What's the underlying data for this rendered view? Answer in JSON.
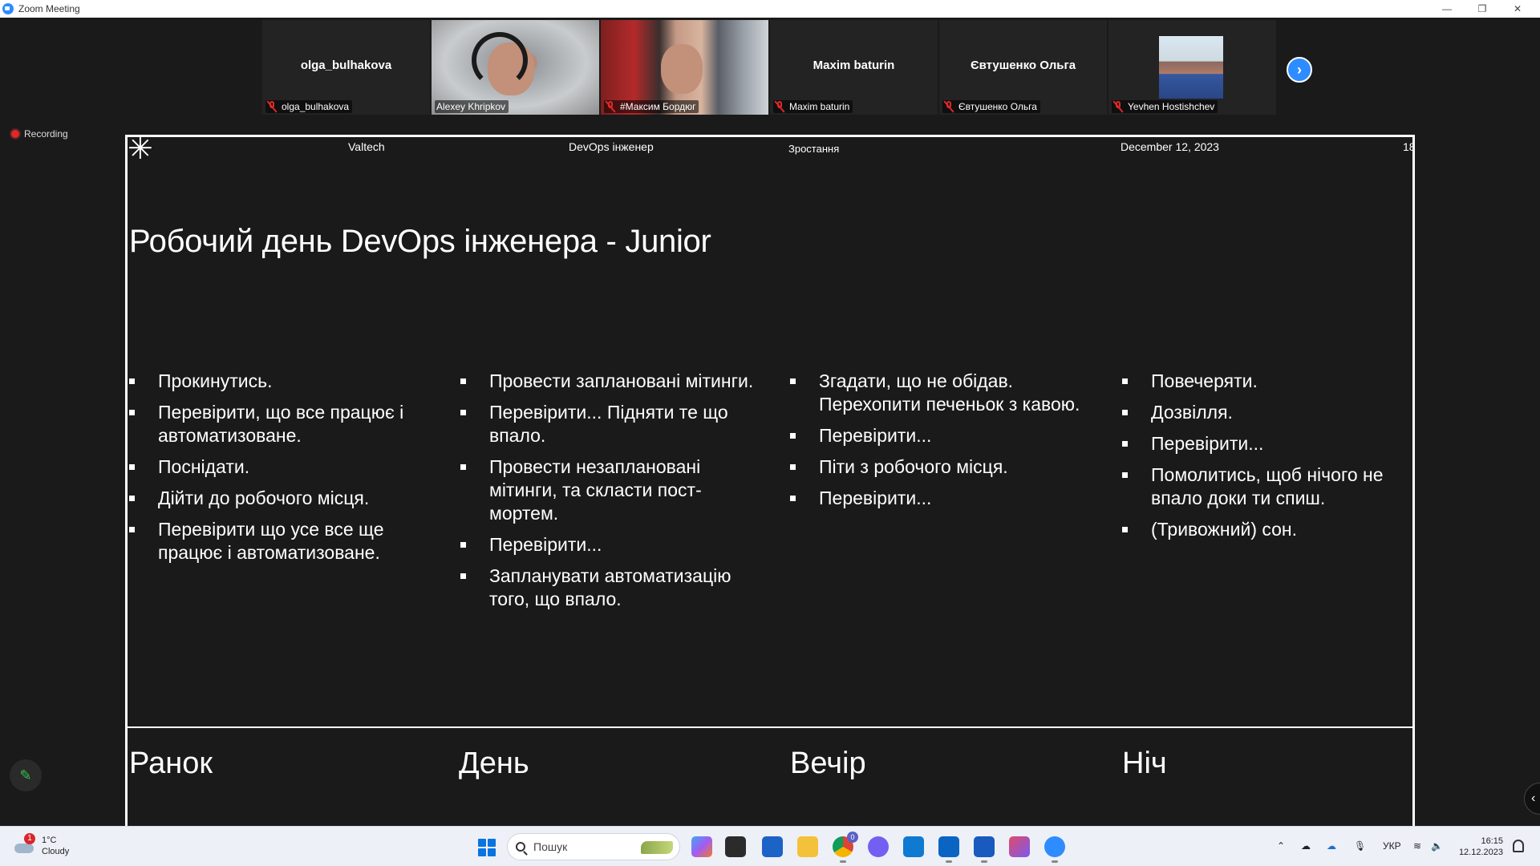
{
  "window": {
    "title": "Zoom Meeting",
    "minimize": "—",
    "restore": "❐",
    "close": "✕"
  },
  "participants": [
    {
      "name": "olga_bulhakova",
      "center_name": "olga_bulhakova",
      "muted": true,
      "video": false
    },
    {
      "name": "Alexey Khripkov",
      "muted": false,
      "video": true,
      "active": true
    },
    {
      "name": "#Максим Бордюг",
      "muted": true,
      "video": true
    },
    {
      "name": "Maxim baturin",
      "center_name": "Maxim baturin",
      "muted": true,
      "video": false
    },
    {
      "name": "Євтушенко Ольга",
      "center_name": "Євтушенко Ольга",
      "muted": true,
      "video": false
    },
    {
      "name": "Yevhen Hostishchev",
      "muted": true,
      "video": false,
      "avatar": true
    }
  ],
  "recording": {
    "label": "Recording"
  },
  "slide": {
    "header": {
      "company": "Valtech",
      "topic": "DevOps інженер",
      "section": "Зростання",
      "date": "December 12, 2023",
      "page": "18"
    },
    "title": "Робочий день DevOps інженера - Junior",
    "columns": [
      {
        "period": "Ранок",
        "items": [
          "Прокинутись.",
          "Перевірити, що все працює і автоматизоване.",
          "Поснідати.",
          "Дійти до робочого місця.",
          "Перевірити що усе все ще працює і автоматизоване."
        ]
      },
      {
        "period": "День",
        "items": [
          "Провести заплановані мітинги.",
          "Перевірити... Підняти те що впало.",
          "Провести незаплановані мітинги, та скласти пост-мортем.",
          "Перевірити...",
          "Запланувати автоматизацію того, що впало."
        ]
      },
      {
        "period": "Вечір",
        "items": [
          "Згадати, що не обідав. Перехопити печеньок з кавою.",
          "Перевірити...",
          "Піти з робочого місця.",
          "Перевірити..."
        ]
      },
      {
        "period": "Ніч",
        "items": [
          "Повечеряти.",
          "Дозвілля.",
          "Перевірити...",
          "Помолитись, щоб нічого не впало доки ти спиш.",
          "(Тривожний) сон."
        ]
      }
    ]
  },
  "taskbar": {
    "weather": {
      "temp": "1°C",
      "condition": "Cloudy",
      "badge": "1"
    },
    "search_placeholder": "Пошук",
    "language": "УКР",
    "time": "16:15",
    "date": "12.12.2023",
    "chrome_badge": "0"
  },
  "colors": {
    "accent": "#2d8cff",
    "active_speaker": "#23d959",
    "muted": "#e02828"
  }
}
